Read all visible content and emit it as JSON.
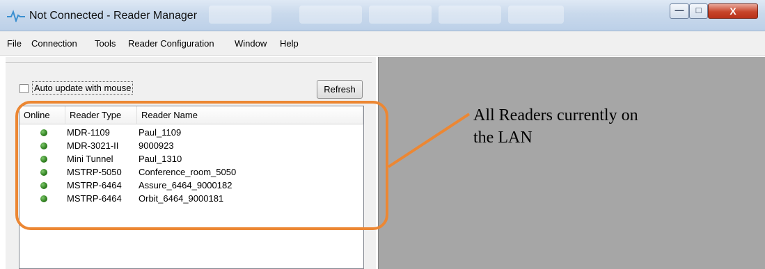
{
  "window": {
    "title": "Not Connected - Reader Manager",
    "controls": {
      "minimize": "—",
      "maximize": "□",
      "close": "X"
    }
  },
  "menu": [
    "File",
    "Connection",
    "Tools",
    "Reader Configuration",
    "Window",
    "Help"
  ],
  "left_pane": {
    "auto_update_label": "Auto update with mouse",
    "auto_update_checked": false,
    "refresh_label": "Refresh",
    "columns": [
      "Online",
      "Reader Type",
      "Reader Name"
    ],
    "rows": [
      {
        "online": true,
        "type": "MDR-1109",
        "name": "Paul_1109"
      },
      {
        "online": true,
        "type": "MDR-3021-II",
        "name": "9000923"
      },
      {
        "online": true,
        "type": "Mini Tunnel",
        "name": "Paul_1310"
      },
      {
        "online": true,
        "type": "MSTRP-5050",
        "name": "Conference_room_5050"
      },
      {
        "online": true,
        "type": "MSTRP-6464",
        "name": "Assure_6464_9000182"
      },
      {
        "online": true,
        "type": "MSTRP-6464",
        "name": "Orbit_6464_9000181"
      }
    ]
  },
  "annotation": {
    "text_line1": "All Readers currently on",
    "text_line2": "the LAN",
    "color": "#ec8733"
  },
  "colors": {
    "online_dot": "#2f7f1f",
    "right_pane_bg": "#a6a6a6"
  }
}
